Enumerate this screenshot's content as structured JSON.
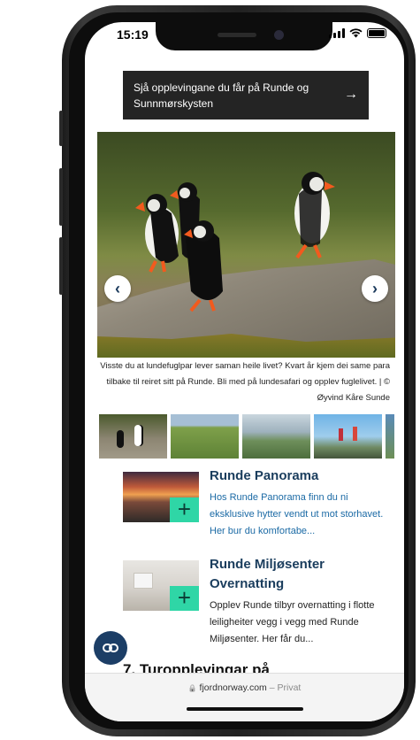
{
  "status": {
    "time": "15:19"
  },
  "banner": {
    "text": "Sjå opplevingane du får på Runde og Sunnmørskysten",
    "arrow": "→"
  },
  "gallery": {
    "caption": "Visste du at lundefuglpar lever saman heile livet? Kvart år kjem dei same para tilbake til reiret sitt på Runde. Bli med på lundesafari og opplev fuglelivet. | © Øyvind Kåre Sunde",
    "prev": "‹",
    "next": "›"
  },
  "cards": [
    {
      "title": "Runde Panorama",
      "desc": "Hos Runde Panorama finn du ni eksklusive hytter vendt ut mot storhavet. Her bur du komfortabe...",
      "plus": "+"
    },
    {
      "title": "Runde Miljøsenter Overnatting",
      "desc": "Opplev Runde tilbyr overnatting i flotte leiligheiter vegg i vegg med Runde Miljøsenter. Her får du...",
      "plus": "+"
    }
  ],
  "float_button": {
    "label": "CO"
  },
  "cut_heading": "7. Turopplevingar på",
  "address_bar": {
    "domain": "fjordnorway.com",
    "separator": " – ",
    "mode": "Privat",
    "lock": "🔒"
  },
  "colors": {
    "banner_bg": "#242424",
    "title_blue": "#1a3d5d",
    "desc_blue": "#1b6aa5",
    "accent_green": "#2fd6a6",
    "float_btn": "#1c3e66"
  }
}
